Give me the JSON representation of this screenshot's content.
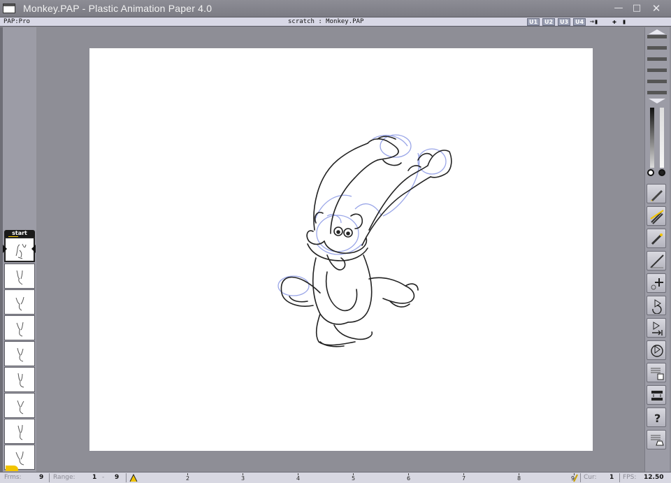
{
  "window": {
    "title": "Monkey.PAP - Plastic Animation Paper 4.0",
    "controls": [
      "minimize",
      "maximize",
      "close"
    ]
  },
  "infobar": {
    "mode": "PAP:Pro",
    "scratch": "scratch : Monkey.PAP",
    "user_buttons": [
      "U1",
      "U2",
      "U3",
      "U4"
    ]
  },
  "lightbox": {
    "start_label": "start",
    "frames": [
      1,
      2,
      3,
      4,
      5,
      6,
      7,
      8,
      9
    ],
    "current_frame": 1
  },
  "status": {
    "frms_label": "Frms:",
    "frms_value": "9",
    "range_label": "Range:",
    "range_from": "1",
    "range_dash": "-",
    "range_to": "9",
    "timeline_ticks": [
      "2",
      "3",
      "4",
      "5",
      "6",
      "7",
      "8",
      "9"
    ],
    "cur_label": "Cur:",
    "cur_value": "1",
    "fps_label": "FPS:",
    "fps_value": "12.50"
  },
  "colors": {
    "title_bar": "#858590",
    "canvas": "#ffffff",
    "background": "#8e8e96",
    "rough_lines": "#9aa6e8",
    "ink_lines": "#222222",
    "marker": "#f2c400"
  },
  "toolbar_icons": [
    "pen-size-icon",
    "eraser-icon",
    "pencil-icon",
    "line-icon",
    "add-frame-icon",
    "play-loop-icon",
    "play-to-end-icon",
    "ping-pong-icon",
    "save-icon",
    "swap-icon",
    "help-icon",
    "open-icon"
  ]
}
